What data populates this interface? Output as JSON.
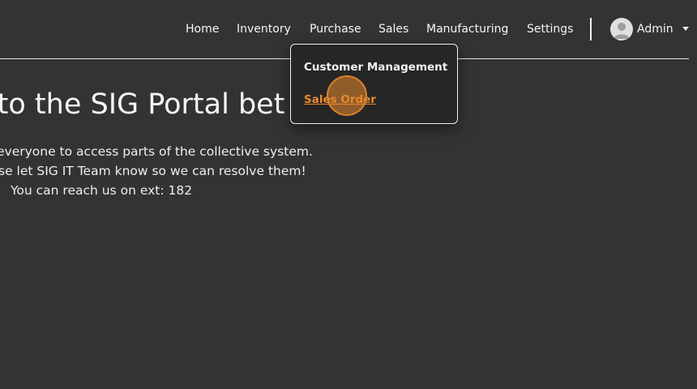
{
  "nav": {
    "items": [
      {
        "label": "Home"
      },
      {
        "label": "Inventory"
      },
      {
        "label": "Purchase"
      },
      {
        "label": "Sales"
      },
      {
        "label": "Manufacturing"
      },
      {
        "label": "Settings"
      }
    ],
    "user": {
      "name": "Admin",
      "avatar_icon": "user-avatar-icon",
      "caret_icon": "caret-down-icon"
    }
  },
  "dropdown": {
    "parent": "Sales",
    "header": "Customer Management",
    "items": [
      {
        "label": "Sales Order"
      }
    ]
  },
  "hero": {
    "title": "e to the SIG Portal bet",
    "lines": [
      "everyone to access parts of the collective system.",
      "se let SIG IT Team know so we can resolve them!",
      "You can reach us on ext: 182"
    ]
  },
  "colors": {
    "background": "#333333",
    "accent": "#e88a2e",
    "dropdown_bg": "#262626",
    "text": "#f5f5f5"
  }
}
